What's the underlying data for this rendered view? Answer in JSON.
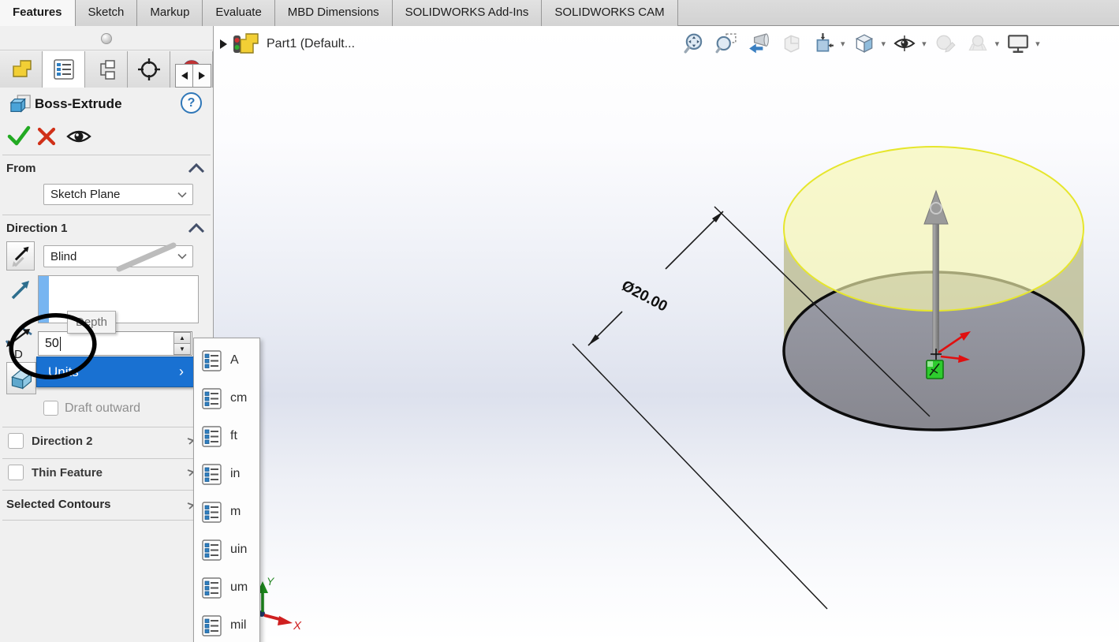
{
  "ribbon_tabs": [
    {
      "label": "Features",
      "active": true
    },
    {
      "label": "Sketch"
    },
    {
      "label": "Markup"
    },
    {
      "label": "Evaluate"
    },
    {
      "label": "MBD Dimensions"
    },
    {
      "label": "SOLIDWORKS Add-Ins"
    },
    {
      "label": "SOLIDWORKS CAM"
    }
  ],
  "panel": {
    "title": "Boss-Extrude",
    "help_glyph": "?",
    "sections": {
      "from": {
        "label": "From",
        "selected_plane": "Sketch Plane"
      },
      "direction1": {
        "label": "Direction 1",
        "end_condition": "Blind",
        "depth_value": "50",
        "depth_tooltip": "Depth",
        "depth_icon_letter": "D",
        "spinner_up": "▲",
        "spinner_down": "▼",
        "draft_outward_label": "Draft outward"
      },
      "direction2": {
        "label": "Direction 2"
      },
      "thin_feature": {
        "label": "Thin Feature"
      },
      "selected_contours": {
        "label": "Selected Contours"
      }
    }
  },
  "context_menu": {
    "highlighted_item": "Units",
    "submenu_arrow": "›"
  },
  "units_menu": {
    "items": [
      "A",
      "cm",
      "ft",
      "in",
      "m",
      "uin",
      "um",
      "mil"
    ]
  },
  "feature_tree": {
    "root_label": "Part1 (Default..."
  },
  "viewport": {
    "dimension_label": "Ø20.00",
    "triad_x": "X",
    "triad_y": "Y"
  },
  "hud": {
    "dropdown_glyph": "▾",
    "buttons": [
      "zoom-to-fit",
      "zoom-to-area",
      "previous-view",
      "section-view",
      "3d-drawing-view",
      "view-orientation",
      "display-style",
      "edit-appearance",
      "apply-scene",
      "view-settings"
    ]
  },
  "colors": {
    "menu_highlight": "#1971d2",
    "preview_yellow": "#f8f8b0",
    "selection_blue": "#77b5f1",
    "confirm_green": "#22aa22",
    "cancel_red": "#d03018"
  }
}
